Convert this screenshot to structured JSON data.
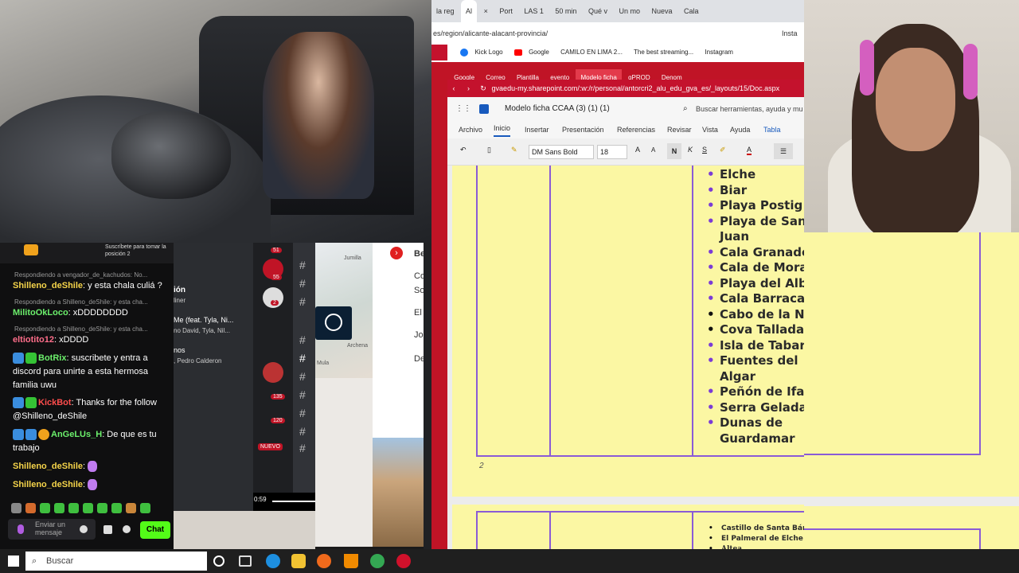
{
  "video": {},
  "chat": {
    "pinned_text": "Suscríbete para tomar la posición 2",
    "messages": [
      {
        "reply": "Respondiendo a vengador_de_kachudos: No...",
        "user": "Shilleno_deShile",
        "text": ": y esta chala culiá ?"
      },
      {
        "reply": "Respondiendo a Shilleno_deShile: y esta cha...",
        "user": "MilitoOkLoco",
        "text": ": xDDDDDDDD"
      },
      {
        "reply": "Respondiendo a Shilleno_deShile: y esta cha...",
        "user": "eltiotito12",
        "text": ": xDDDD"
      },
      {
        "user": "BotRix",
        "text": ": suscribete y entra a discord para unirte a esta hermosa familia uwu"
      },
      {
        "user": "KickBot",
        "text": ": Thanks for the follow @Shilleno_deShile"
      },
      {
        "user": "AnGeLUs_H",
        "text": ": De que es tu trabajo"
      },
      {
        "user": "Shilleno_deShile",
        "text": ":"
      },
      {
        "user": "Shilleno_deShile",
        "text": ":"
      }
    ],
    "input_placeholder": "Enviar un mensaje",
    "chat_button": "Chat"
  },
  "middle": {
    "item1": "ión",
    "item2": "liner",
    "song": "Me (feat. Tyla, Ni...",
    "artists": "no David, Tyla, Nil...",
    "item3": "nos",
    "item4": ", Pedro Calderon",
    "time": "0:59",
    "badges": [
      "51",
      "55",
      "2",
      "135",
      "120"
    ],
    "nuevo": "NUEVO"
  },
  "rightcol": {
    "lines": [
      "Be",
      "Co",
      "So",
      "El",
      "Jo",
      "De"
    ]
  },
  "map": {
    "labels": [
      "Jumilla",
      "Archena",
      "Mula"
    ]
  },
  "browser": {
    "tabs": [
      "la reg",
      "Al",
      "Port",
      "LAS 1",
      "50 min",
      "Qué v",
      "Un mo",
      "Nueva",
      "Cala"
    ],
    "url": "es/region/alicante-alacant-provincia/",
    "insta_button": "Insta",
    "bookmarks": [
      "Kick Logo",
      "Google",
      "CAMILO EN LIMA 2...",
      "The best streaming...",
      "Instagram"
    ],
    "tabs2": [
      "Google",
      "Correo",
      "Plantilla",
      "evento",
      "Modelo ficha",
      "gPROD",
      "Denom"
    ],
    "url2": "gvaedu-my.sharepoint.com/:w:/r/personal/antorcri2_alu_edu_gva_es/_layouts/15/Doc.aspx",
    "doc_title": "Modelo ficha CCAA (3) (1) (1)",
    "search_placeholder": "Buscar herramientas, ayuda y mu",
    "ribbon": [
      "Archivo",
      "Inicio",
      "Insertar",
      "Presentación",
      "Referencias",
      "Revisar",
      "Vista",
      "Ayuda",
      "Tabla"
    ],
    "font": "DM Sans Bold",
    "size": "18",
    "places": [
      "Elche",
      "Biar",
      "Playa Postig",
      "Playa de San Juan",
      "Cala Granadella",
      "Cala de Moraig",
      "Playa del Albir",
      "Cala Barraca",
      "Cabo de la Nao",
      "Cova Tallada",
      "Isla de Tabarca",
      "Fuentes del Algar",
      "Peñón de Ifach",
      "Serra Gelada",
      "Dunas de Guardamar"
    ],
    "page_number": "2",
    "page2_items": [
      "Castillo de Santa Bárbara",
      "El Palmeral de Elche",
      "Altea"
    ]
  },
  "taskbar": {
    "search": "Buscar"
  }
}
